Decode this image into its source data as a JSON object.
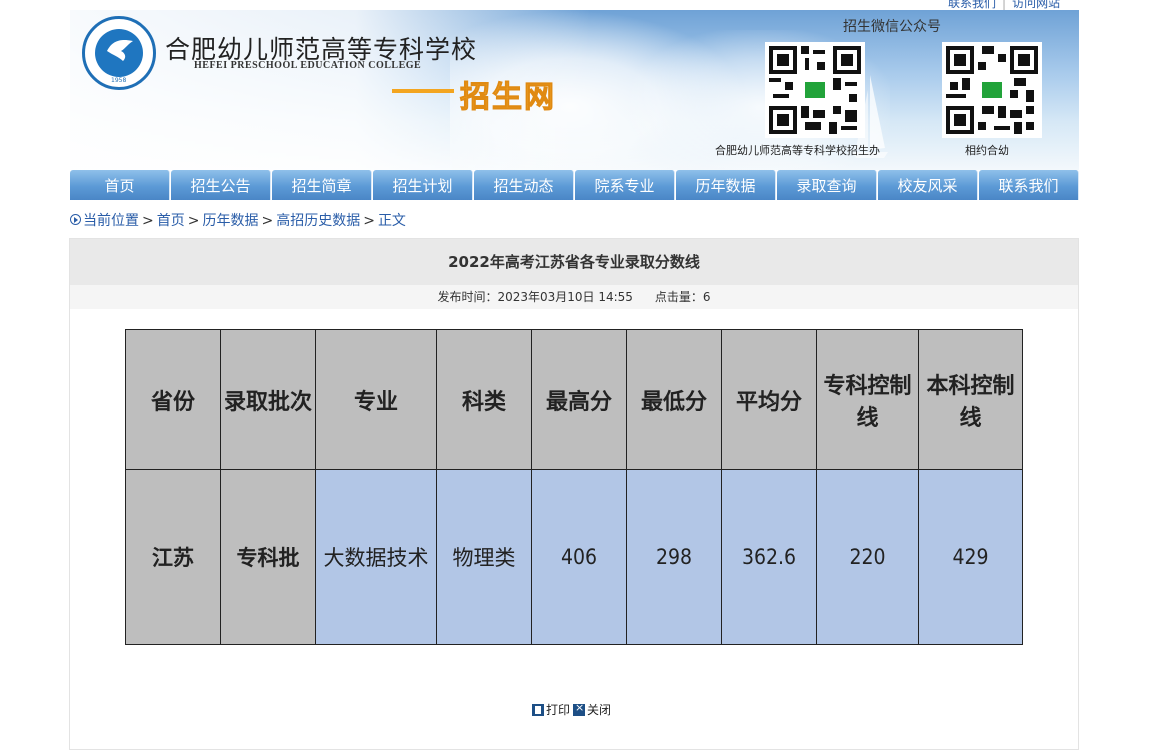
{
  "top_links": [
    "联系我们",
    "访问网站"
  ],
  "header": {
    "school_name_cn": "合肥幼儿师范高等专科学校",
    "school_name_en": "HEFEI PRESCHOOL EDUCATION COLLEGE",
    "site_name": "招生网",
    "logo_year": "1958",
    "wechat_title": "招生微信公众号",
    "qr_captions": [
      "合肥幼儿师范高等专科学校招生办",
      "相约合幼"
    ]
  },
  "nav": [
    "首页",
    "招生公告",
    "招生简章",
    "招生计划",
    "招生动态",
    "院系专业",
    "历年数据",
    "录取查询",
    "校友风采",
    "联系我们"
  ],
  "breadcrumb": {
    "items": [
      "当前位置",
      "首页",
      "历年数据",
      "高招历史数据",
      "正文"
    ]
  },
  "article": {
    "title": "2022年高考江苏省各专业录取分数线",
    "publish_time": "发布时间：2023年03月10日 14:55",
    "hits": "点击量：6",
    "table": {
      "headers": [
        "省份",
        "录取批次",
        "专业",
        "科类",
        "最高分",
        "最低分",
        "平均分",
        "专科控制线",
        "本科控制线"
      ],
      "rows": [
        [
          "江苏",
          "专科批",
          "大数据技术",
          "物理类",
          "406",
          "298",
          "362.6",
          "220",
          "429"
        ]
      ]
    },
    "print_label": "打印",
    "close_label": "关闭"
  }
}
